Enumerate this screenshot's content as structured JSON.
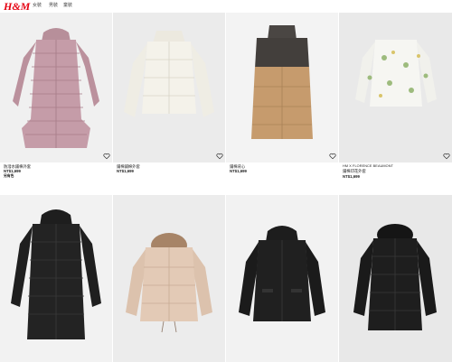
{
  "header": {
    "logo_text": "H&M",
    "nav": [
      "女裝",
      "男裝",
      "童裝"
    ]
  },
  "products": [
    {
      "name": "防潑水鋪棉外套",
      "price": "NT$1,699",
      "extra": "另有色",
      "brand": ""
    },
    {
      "name": "鋪棉鋪棉外套",
      "price": "NT$1,699",
      "extra": "",
      "brand": ""
    },
    {
      "name": "鋪棉背心",
      "price": "NT$1,699",
      "extra": "",
      "brand": ""
    },
    {
      "name": "鋪棉印花外套",
      "price": "NT$1,699",
      "extra": "",
      "brand": "HM X FLORENCE BEAUMONT"
    },
    {
      "name": "",
      "price": "",
      "extra": "",
      "brand": ""
    },
    {
      "name": "",
      "price": "",
      "extra": "",
      "brand": ""
    },
    {
      "name": "",
      "price": "",
      "extra": "",
      "brand": ""
    },
    {
      "name": "",
      "price": "",
      "extra": "",
      "brand": ""
    }
  ],
  "icons": {
    "favorite": "heart-outline-icon"
  },
  "colors": {
    "brand_red": "#e50010",
    "image_bg": "#efefef"
  }
}
